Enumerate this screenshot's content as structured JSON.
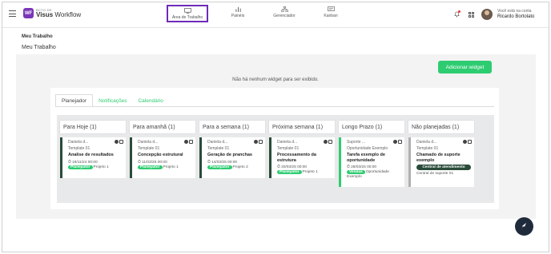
{
  "header": {
    "logo_small": "BCTO DE",
    "logo_brand": "Visus",
    "logo_product": " Workflow",
    "logo_mark": "WF",
    "nav": [
      {
        "label": "Área de Trabalho",
        "icon": "monitor-icon",
        "active": true
      },
      {
        "label": "Painéis",
        "icon": "bar-chart-icon",
        "active": false
      },
      {
        "label": "Gerenciador",
        "icon": "sitemap-icon",
        "active": false
      },
      {
        "label": "Kanban",
        "icon": "kanban-icon",
        "active": false
      }
    ],
    "user_caption": "Você está na conta",
    "user_name": "Ricardo Bortolato"
  },
  "breadcrumb": "Meu Trabalho",
  "page_title": "Meu Trabalho",
  "add_widget_label": "Adicionar widget",
  "empty_message": "Não há nenhum widget para ser exibido.",
  "tabs": [
    "Planejador",
    "Notificações",
    "Calendário"
  ],
  "columns": [
    {
      "title": "Para Hoje (1)",
      "card": {
        "user": "Daniela d...",
        "template": "Template 01",
        "title": "Analise de resultados",
        "date": "18/11/24 00:00",
        "badge": "Planejador",
        "project": "Projeto 1"
      }
    },
    {
      "title": "Para amanhã (1)",
      "card": {
        "user": "Daniela d...",
        "template": "Template 01",
        "title": "Concepção estrutural",
        "date": "11/03/25 00:00",
        "badge": "Planejador",
        "project": "Projeto 1"
      }
    },
    {
      "title": "Para a semana (1)",
      "card": {
        "user": "Daniela d...",
        "template": "Template 01",
        "title": "Geração de pranchas",
        "date": "14/03/25 00:00",
        "badge": "Planejador",
        "project": "Projeto 2"
      }
    },
    {
      "title": "Próxima semana (1)",
      "card": {
        "user": "Daniela d...",
        "template": "Template 01",
        "title": "Processamento da estrutura",
        "date": "20/03/25 00:00",
        "badge": "Planejador",
        "project": "Projeto 1"
      }
    },
    {
      "title": "Longo Prazo (1)",
      "card": {
        "user": "Suporte ...",
        "template": "Oportunidade Exemplo",
        "title": "Tarefa exemplo de oportunidade",
        "date": "28/03/25 00:00",
        "badge": "Vendas",
        "project": "Oportunidade Exemplo"
      }
    },
    {
      "title": "Não planejadas (1)",
      "card": {
        "user": "Daniela d...",
        "template": "Template 01",
        "title": "Chamado de suporte exemplo",
        "date": "",
        "badge": "Central de atendimento",
        "project": "Central de suporte 01"
      }
    }
  ],
  "colors": {
    "accent": "#2ecc71",
    "brand": "#7a36b8",
    "dark_badge": "#2a4b3a"
  }
}
